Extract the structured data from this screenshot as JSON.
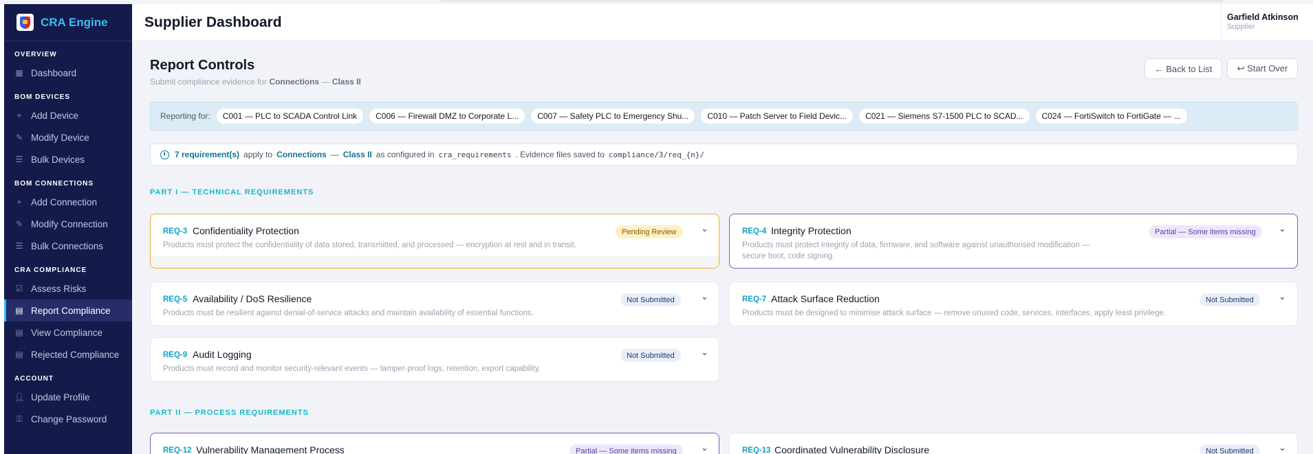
{
  "app": {
    "name": "CRA Engine"
  },
  "sidebar": {
    "sections": [
      {
        "title": "OVERVIEW",
        "items": [
          {
            "label": "Dashboard",
            "icon": "grid-icon"
          }
        ]
      },
      {
        "title": "BOM DEVICES",
        "items": [
          {
            "label": "Add Device",
            "icon": "plus-icon"
          },
          {
            "label": "Modify Device",
            "icon": "pencil-icon"
          },
          {
            "label": "Bulk Devices",
            "icon": "list-icon"
          }
        ]
      },
      {
        "title": "BOM CONNECTIONS",
        "items": [
          {
            "label": "Add Connection",
            "icon": "plus-icon"
          },
          {
            "label": "Modify Connection",
            "icon": "pencil-icon"
          },
          {
            "label": "Bulk Connections",
            "icon": "list-icon"
          }
        ]
      },
      {
        "title": "CRA COMPLIANCE",
        "items": [
          {
            "label": "Assess Risks",
            "icon": "checkbox-icon"
          },
          {
            "label": "Report Compliance",
            "icon": "document-icon",
            "active": true
          },
          {
            "label": "View Compliance",
            "icon": "document-icon"
          },
          {
            "label": "Rejected Compliance",
            "icon": "document-icon"
          }
        ]
      },
      {
        "title": "ACCOUNT",
        "items": [
          {
            "label": "Update Profile",
            "icon": "user-icon"
          },
          {
            "label": "Change Password",
            "icon": "lock-icon"
          }
        ]
      }
    ]
  },
  "header": {
    "title": "Supplier Dashboard",
    "user_name": "Garfield Atkinson",
    "user_role": "Supplier"
  },
  "page": {
    "title": "Report Controls",
    "subtitle_prefix": "Submit compliance evidence for",
    "subtitle_type": "Connections",
    "subtitle_sep": "—",
    "subtitle_class": "Class II",
    "back_label": "← Back to List",
    "start_over_label": "↩ Start Over"
  },
  "reporting": {
    "label": "Reporting for:",
    "chips": [
      "C001 — PLC to SCADA Control Link",
      "C006 — Firewall DMZ to Corporate L...",
      "C007 — Safety PLC to Emergency Shu...",
      "C010 — Patch Server to Field Devic...",
      "C021 — Siemens S7-1500 PLC to SCAD...",
      "C024 — FortiSwitch to FortiGate — ..."
    ]
  },
  "info": {
    "count": "7 requirement(s)",
    "apply_to": "apply to",
    "type": "Connections",
    "sep": "—",
    "class": "Class II",
    "configured_in": "as configured in",
    "table": "cra_requirements",
    "saved_to": ". Evidence files saved to",
    "path": "compliance/3/req_{n}/"
  },
  "sections": {
    "technical": "PART I — TECHNICAL REQUIREMENTS",
    "process": "PART II — PROCESS REQUIREMENTS"
  },
  "requirements": [
    {
      "id": "REQ-3",
      "title": "Confidentiality Protection",
      "status": "Pending Review",
      "desc": "Products must protect the confidentiality of data stored, transmitted, and processed — encryption at rest and in transit."
    },
    {
      "id": "REQ-4",
      "title": "Integrity Protection",
      "status": "Partial — Some items missing",
      "desc_1": "Products must protect integrity of data, firmware, and software against unauthorised modification —",
      "desc_2": "secure boot, code signing."
    },
    {
      "id": "REQ-5",
      "title": "Availability / DoS Resilience",
      "status": "Not Submitted",
      "desc": "Products must be resilient against denial-of-service attacks and maintain availability of essential functions."
    },
    {
      "id": "REQ-7",
      "title": "Attack Surface Reduction",
      "status": "Not Submitted",
      "desc": "Products must be designed to minimise attack surface — remove unused code, services, interfaces, apply least privilege."
    },
    {
      "id": "REQ-9",
      "title": "Audit Logging",
      "status": "Not Submitted",
      "desc": "Products must record and monitor security-relevant events — tamper-proof logs, retention, export capability."
    },
    {
      "id": "REQ-12",
      "title": "Vulnerability Management Process",
      "status": "Partial — Some items missing"
    },
    {
      "id": "REQ-13",
      "title": "Coordinated Vulnerability Disclosure",
      "status": "Not Submitted"
    }
  ],
  "colors": {
    "accent": "#0ea5c4",
    "sidebar": "#141a4a",
    "pending_border": "#e6b12e",
    "partial_border": "#7c5cc4"
  }
}
